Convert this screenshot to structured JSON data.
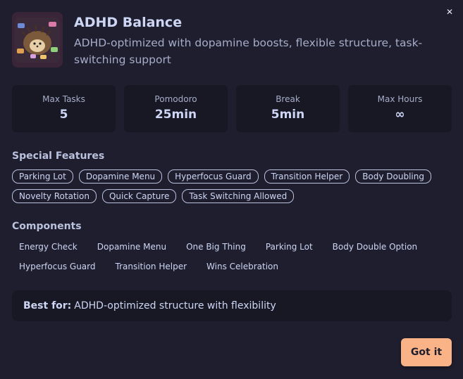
{
  "close_glyph": "✕",
  "header": {
    "title": "ADHD Balance",
    "subtitle": "ADHD-optimized with dopamine boosts, flexible structure, task-switching support",
    "icon": "hedgehog-illustration-icon"
  },
  "stats": [
    {
      "label": "Max Tasks",
      "value": "5"
    },
    {
      "label": "Pomodoro",
      "value": "25min"
    },
    {
      "label": "Break",
      "value": "5min"
    },
    {
      "label": "Max Hours",
      "value": "∞"
    }
  ],
  "features": {
    "title": "Special Features",
    "items": [
      "Parking Lot",
      "Dopamine Menu",
      "Hyperfocus Guard",
      "Transition Helper",
      "Body Doubling",
      "Novelty Rotation",
      "Quick Capture",
      "Task Switching Allowed"
    ]
  },
  "components": {
    "title": "Components",
    "items": [
      "Energy Check",
      "Dopamine Menu",
      "One Big Thing",
      "Parking Lot",
      "Body Double Option",
      "Hyperfocus Guard",
      "Transition Helper",
      "Wins Celebration"
    ]
  },
  "best_for": {
    "label": "Best for:",
    "text": "ADHD-optimized structure with flexibility"
  },
  "confirm_label": "Got it",
  "colors": {
    "background": "#1e1e2e",
    "card": "#181825",
    "accent": "#fab387"
  }
}
